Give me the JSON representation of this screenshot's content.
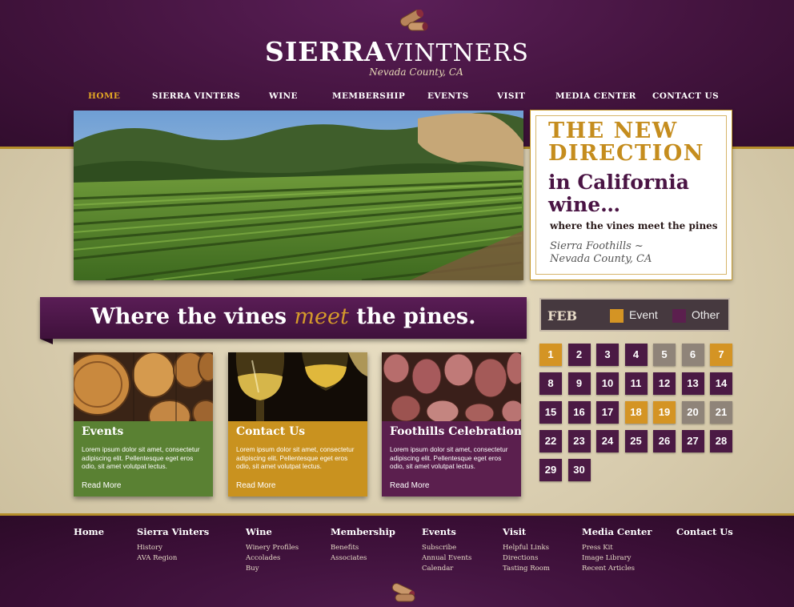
{
  "brand": {
    "name_part1": "SIERRA",
    "name_part2": "VINTNERS",
    "tagline": "Nevada County, CA"
  },
  "nav": [
    {
      "label": "HOME",
      "active": true
    },
    {
      "label": "SIERRA VINTERS",
      "active": false
    },
    {
      "label": "WINE",
      "active": false
    },
    {
      "label": "MEMBERSHIP",
      "active": false
    },
    {
      "label": "EVENTS",
      "active": false
    },
    {
      "label": "VISIT",
      "active": false
    },
    {
      "label": "MEDIA CENTER",
      "active": false
    },
    {
      "label": "CONTACT US",
      "active": false
    }
  ],
  "feature": {
    "heading_line1": "THE NEW",
    "heading_line2": "DIRECTION",
    "sub_line1": "in California",
    "sub_line2": "wine…",
    "slogan": "where the vines meet the pines",
    "location_line1": "Sierra Foothills ~",
    "location_line2": "Nevada County, CA"
  },
  "banner": {
    "before": "Where the vines",
    "highlight": "meet",
    "after": "the pines."
  },
  "cards": [
    {
      "title": "Events",
      "text": "Lorem ipsum dolor sit amet, consectetur adipiscing elit. Pellentesque eget eros odio, sit amet volutpat lectus.",
      "more": "Read More",
      "color": "#5a8133"
    },
    {
      "title": "Contact Us",
      "text": "Lorem ipsum dolor sit amet, consectetur adipiscing elit. Pellentesque eget eros odio, sit amet volutpat lectus.",
      "more": "Read More",
      "color": "#c9921f"
    },
    {
      "title": "Foothills Celebration",
      "text": "Lorem ipsum dolor sit amet, consectetur adipiscing elit. Pellentesque eget eros odio, sit amet volutpat lectus.",
      "more": "Read More",
      "color": "#5b1f4e"
    }
  ],
  "calendar": {
    "month": "FEB",
    "legend_event": "Event",
    "legend_other": "Other",
    "colors": {
      "event": "#d49424",
      "other": "#5b1f4e",
      "muted": "#8f8479",
      "day": "#4b1a44"
    },
    "days": [
      {
        "n": "1",
        "t": "event"
      },
      {
        "n": "2",
        "t": "day"
      },
      {
        "n": "3",
        "t": "day"
      },
      {
        "n": "4",
        "t": "day"
      },
      {
        "n": "5",
        "t": "muted"
      },
      {
        "n": "6",
        "t": "muted"
      },
      {
        "n": "7",
        "t": "event"
      },
      {
        "n": "8",
        "t": "day"
      },
      {
        "n": "9",
        "t": "day"
      },
      {
        "n": "10",
        "t": "day"
      },
      {
        "n": "11",
        "t": "day"
      },
      {
        "n": "12",
        "t": "day"
      },
      {
        "n": "13",
        "t": "day"
      },
      {
        "n": "14",
        "t": "day"
      },
      {
        "n": "15",
        "t": "day"
      },
      {
        "n": "16",
        "t": "day"
      },
      {
        "n": "17",
        "t": "day"
      },
      {
        "n": "18",
        "t": "event"
      },
      {
        "n": "19",
        "t": "event"
      },
      {
        "n": "20",
        "t": "muted"
      },
      {
        "n": "21",
        "t": "muted"
      },
      {
        "n": "22",
        "t": "day"
      },
      {
        "n": "23",
        "t": "day"
      },
      {
        "n": "24",
        "t": "day"
      },
      {
        "n": "25",
        "t": "day"
      },
      {
        "n": "26",
        "t": "day"
      },
      {
        "n": "27",
        "t": "day"
      },
      {
        "n": "28",
        "t": "day"
      },
      {
        "n": "29",
        "t": "day"
      },
      {
        "n": "30",
        "t": "day"
      }
    ]
  },
  "footer": [
    {
      "heading": "Home",
      "links": []
    },
    {
      "heading": "Sierra Vinters",
      "links": [
        "History",
        "AVA Region"
      ]
    },
    {
      "heading": "Wine",
      "links": [
        "Winery Profiles",
        "Accolades",
        "Buy"
      ]
    },
    {
      "heading": "Membership",
      "links": [
        "Benefits",
        "Associates"
      ]
    },
    {
      "heading": "Events",
      "links": [
        "Subscribe",
        "Annual Events",
        "Calendar"
      ]
    },
    {
      "heading": "Visit",
      "links": [
        "Helpful Links",
        "Directions",
        "Tasting Room"
      ]
    },
    {
      "heading": "Media Center",
      "links": [
        "Press Kit",
        "Image Library",
        "Recent Articles"
      ]
    },
    {
      "heading": "Contact Us",
      "links": []
    }
  ]
}
